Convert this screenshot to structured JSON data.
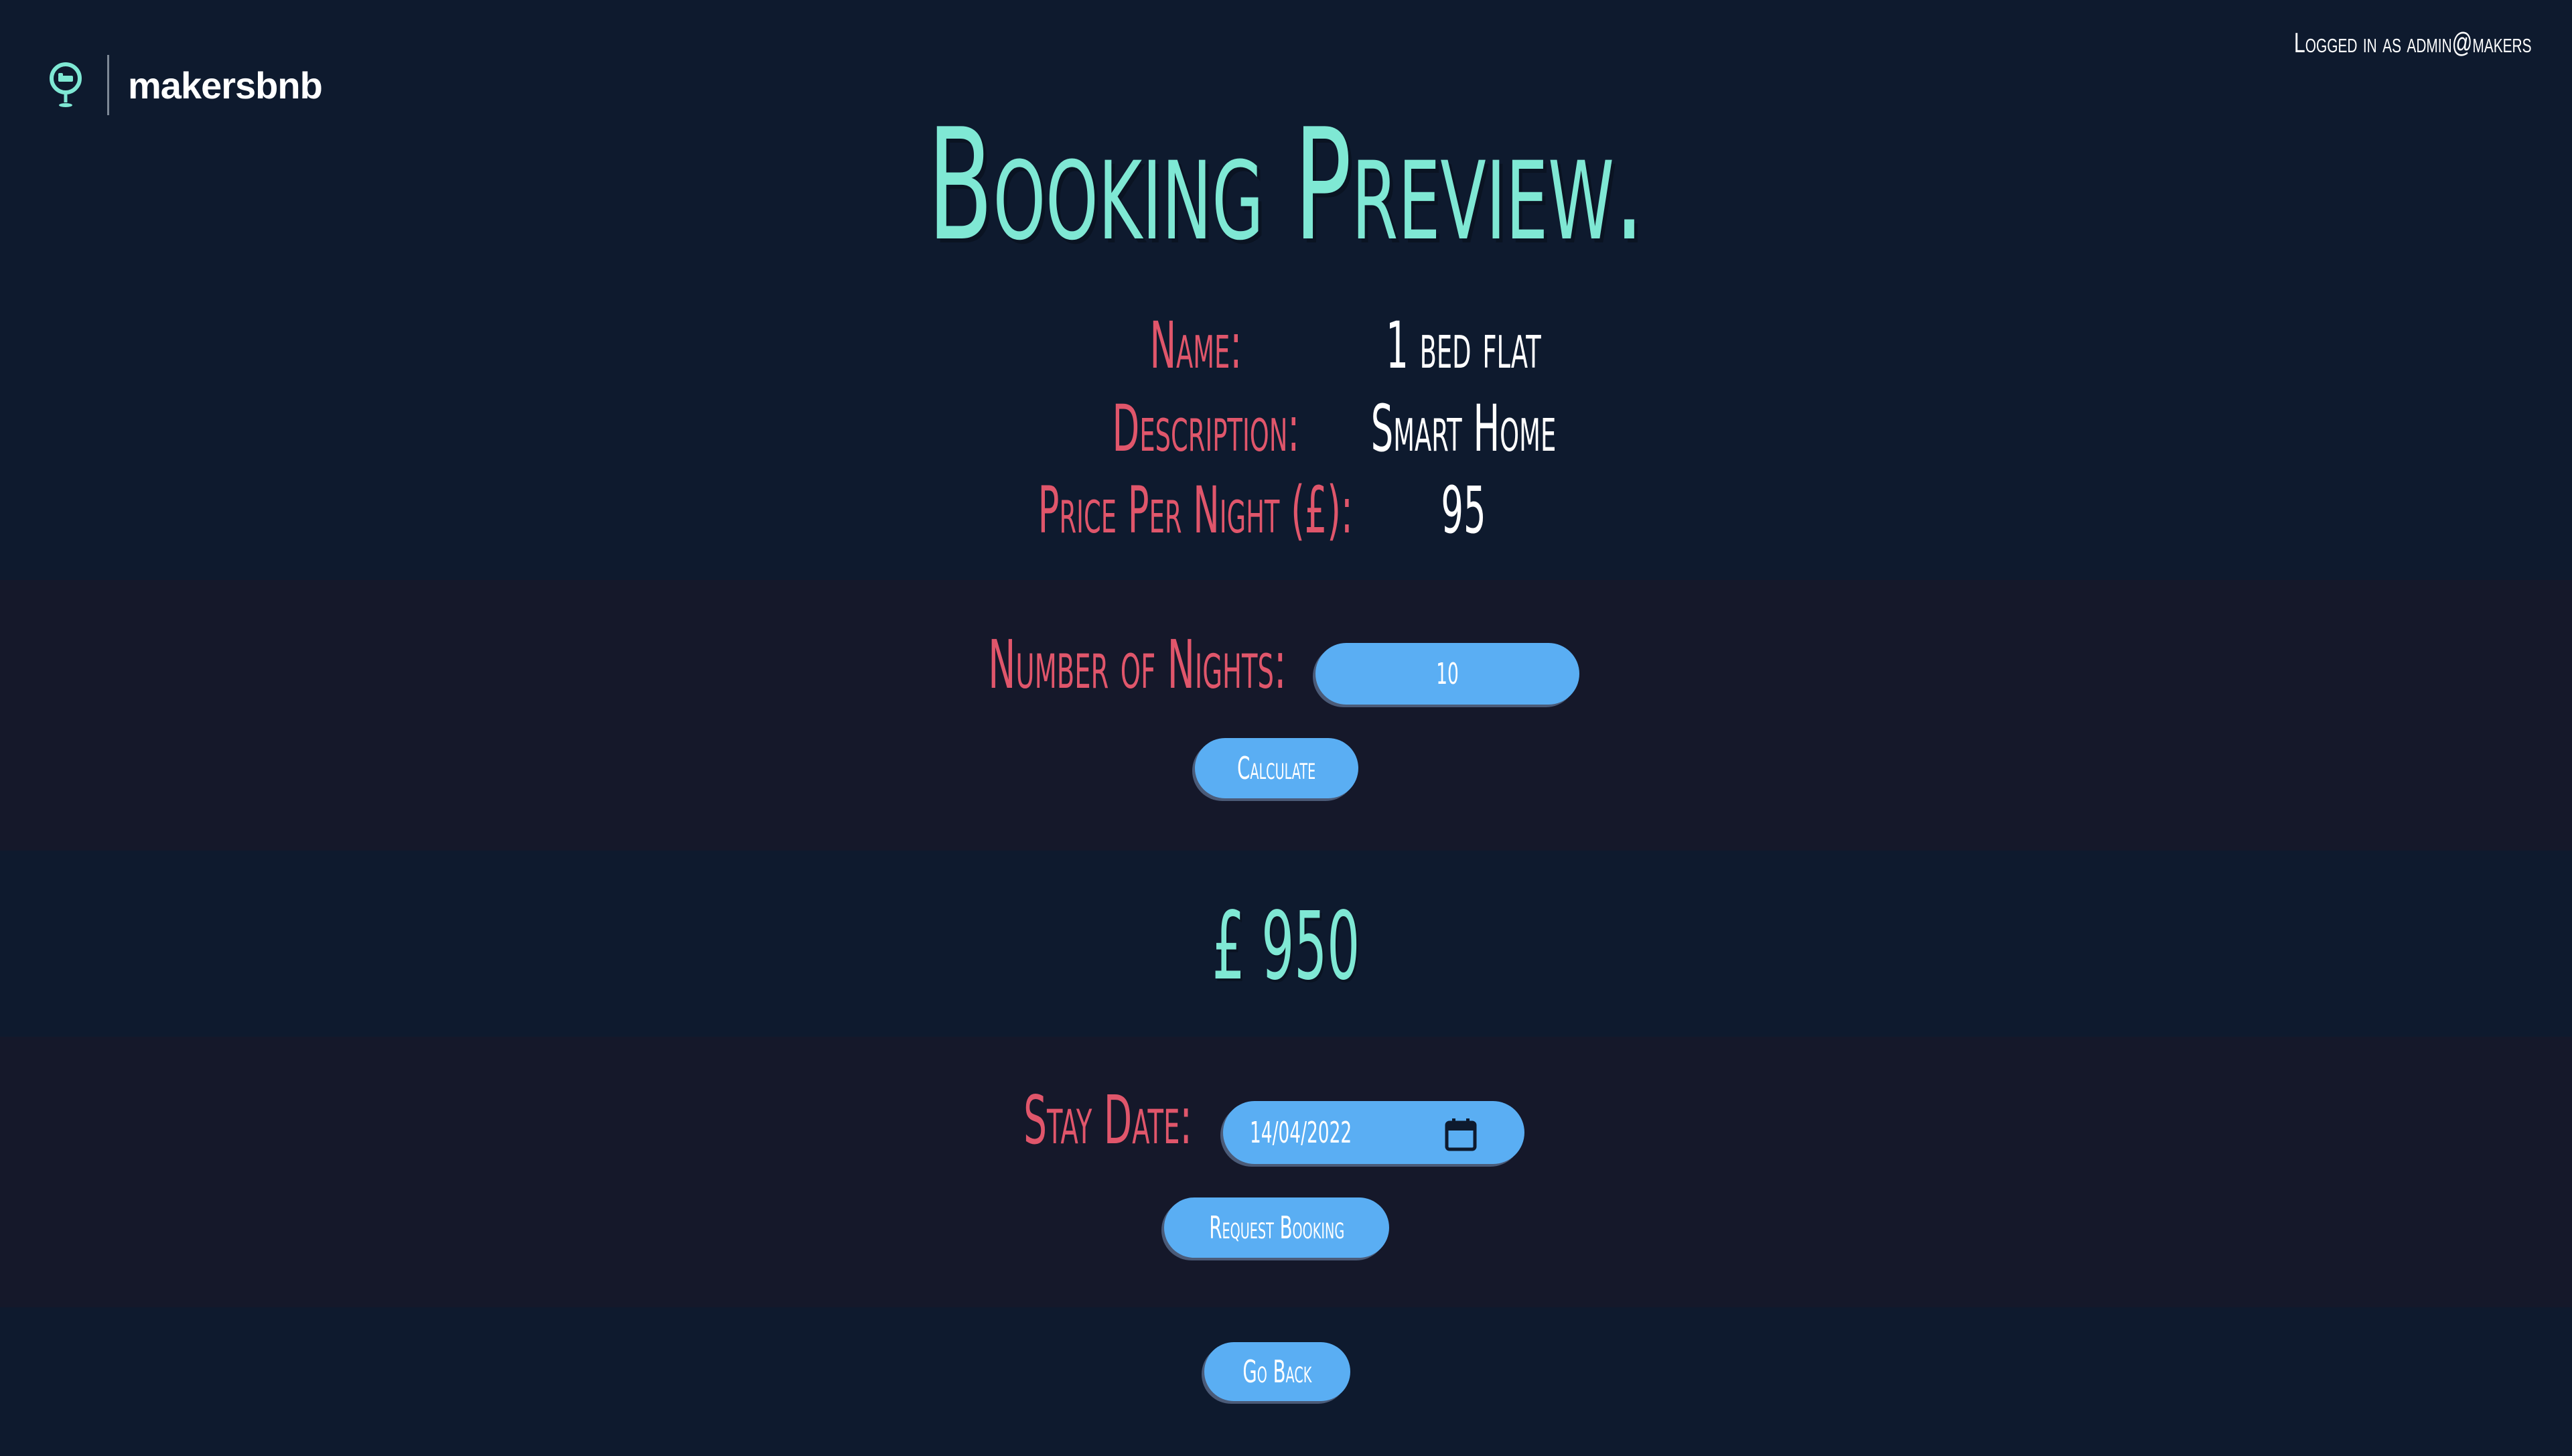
{
  "header": {
    "brand": "makersbnb",
    "login_status": "Logged in as admin@makers"
  },
  "page": {
    "title": "Booking Preview."
  },
  "details": {
    "name_label": "Name:",
    "name_value": "1 bed flat",
    "description_label": "Description:",
    "description_value": "Smart Home",
    "price_label": "Price Per Night (£):",
    "price_value": "95"
  },
  "calculator": {
    "nights_label": "Number of Nights:",
    "nights_value": "10",
    "calculate_label": "Calculate"
  },
  "total": {
    "currency": "£",
    "amount": "950"
  },
  "booking": {
    "date_label": "Stay Date:",
    "date_value": "14/04/2022",
    "request_label": "Request Booking"
  },
  "footer": {
    "back_label": "Go Back"
  },
  "colors": {
    "background": "#0e1a2e",
    "band": "#15182a",
    "accent_teal": "#7fe8d4",
    "label_pink": "#e0566b",
    "button_blue": "#5aaef3"
  },
  "icons": {
    "logo": "map-pin-bed-icon",
    "date": "calendar-icon"
  }
}
